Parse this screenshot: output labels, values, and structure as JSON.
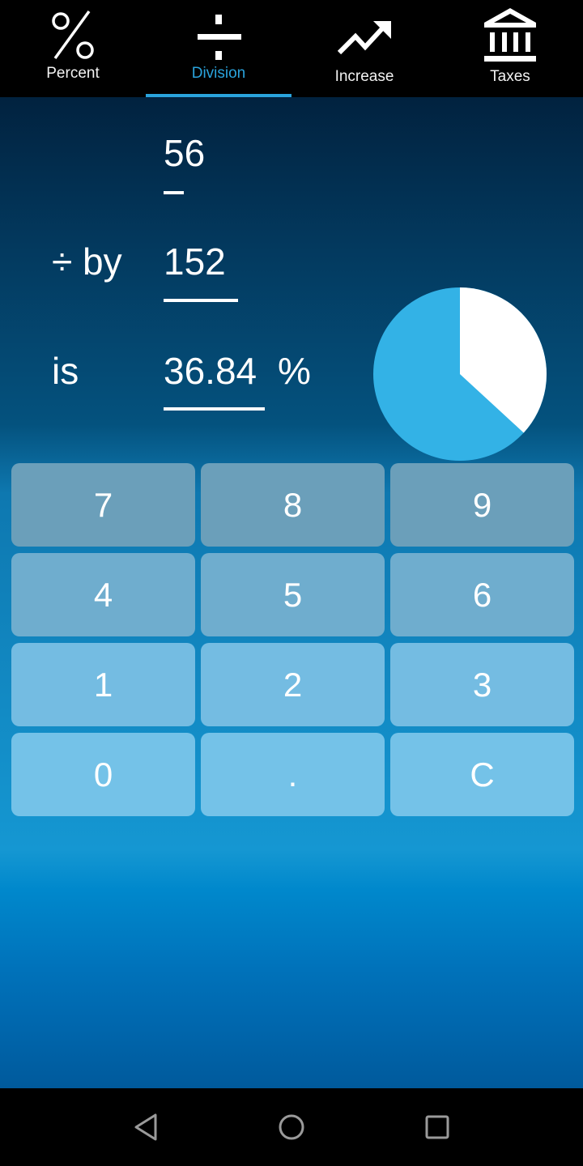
{
  "tabs": [
    {
      "label": "Percent",
      "icon": "percent-icon",
      "active": false
    },
    {
      "label": "Division",
      "icon": "divide-icon",
      "active": true
    },
    {
      "label": "Increase",
      "icon": "trending-up-icon",
      "active": false
    },
    {
      "label": "Taxes",
      "icon": "bank-icon",
      "active": false
    }
  ],
  "calculator": {
    "numerator": "56",
    "divide_label": "÷ by",
    "denominator": "152",
    "result_label": "is",
    "result": "36.84",
    "result_unit": "%"
  },
  "pie": {
    "result_fraction": 0.3684,
    "result_color": "#ffffff",
    "remainder_color": "#33b2e6"
  },
  "keypad": {
    "keys": [
      "7",
      "8",
      "9",
      "4",
      "5",
      "6",
      "1",
      "2",
      "3",
      "0",
      ".",
      "C"
    ]
  },
  "colors": {
    "accent": "#2aa3dc"
  },
  "navbar": {
    "buttons": [
      "back",
      "home",
      "recents"
    ]
  }
}
